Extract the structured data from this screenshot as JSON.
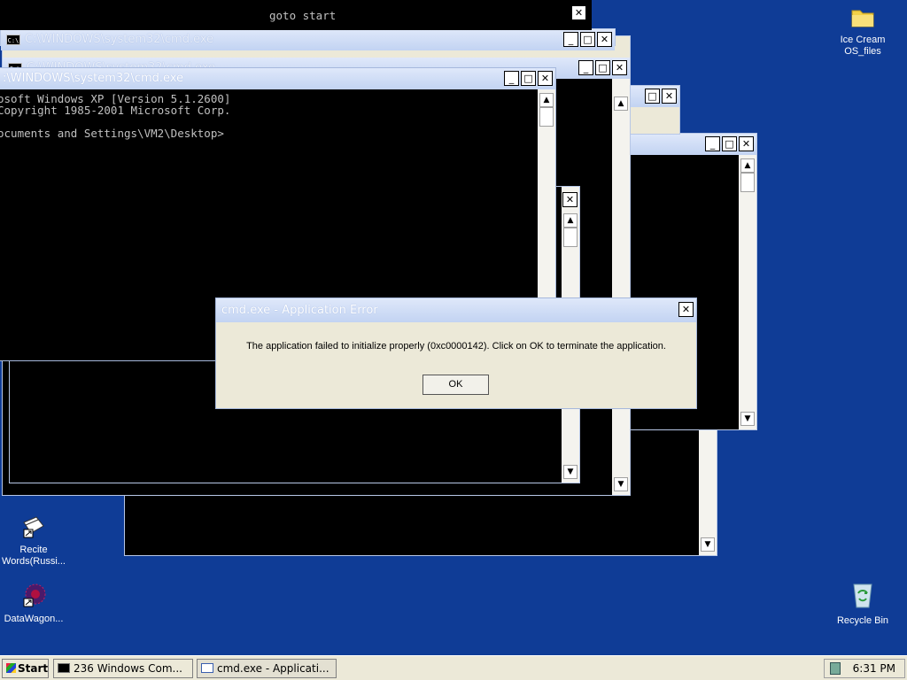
{
  "windows": {
    "cmd_title": "C:\\WINDOWS\\system32\\cmd.exe",
    "top_partial_text": "goto start",
    "top_left_frag": "C:\\",
    "front_title": ":\\WINDOWS\\system32\\cmd.exe",
    "front_console": "osoft Windows XP [Version 5.1.2600]\nCopyright 1985-2001 Microsoft Corp.\n\nocuments and Settings\\VM2\\Desktop>",
    "btn_min": "_",
    "btn_max": "□",
    "btn_close": "✕"
  },
  "dialog": {
    "title": "cmd.exe - Application Error",
    "message": "The application failed to initialize properly (0xc0000142). Click on OK to terminate the application.",
    "ok_label": "OK",
    "close": "✕"
  },
  "desktop_icons": [
    {
      "label": "Ice Cream OS_files",
      "icon": "folder-icon"
    },
    {
      "label": "Recite Words(Russi...",
      "icon": "book-shortcut-icon"
    },
    {
      "label": "DataWagon...",
      "icon": "datawagon-shortcut-icon"
    },
    {
      "label": "Recycle Bin",
      "icon": "recycle-bin-icon"
    }
  ],
  "taskbar": {
    "start_label": "Start",
    "task1": "236 Windows Com...",
    "task2": "cmd.exe - Applicati...",
    "clock": "6:31 PM"
  },
  "colors": {
    "desktop": "#0f3c96",
    "titlebar": "#c2d3f2",
    "console": "#000000"
  }
}
